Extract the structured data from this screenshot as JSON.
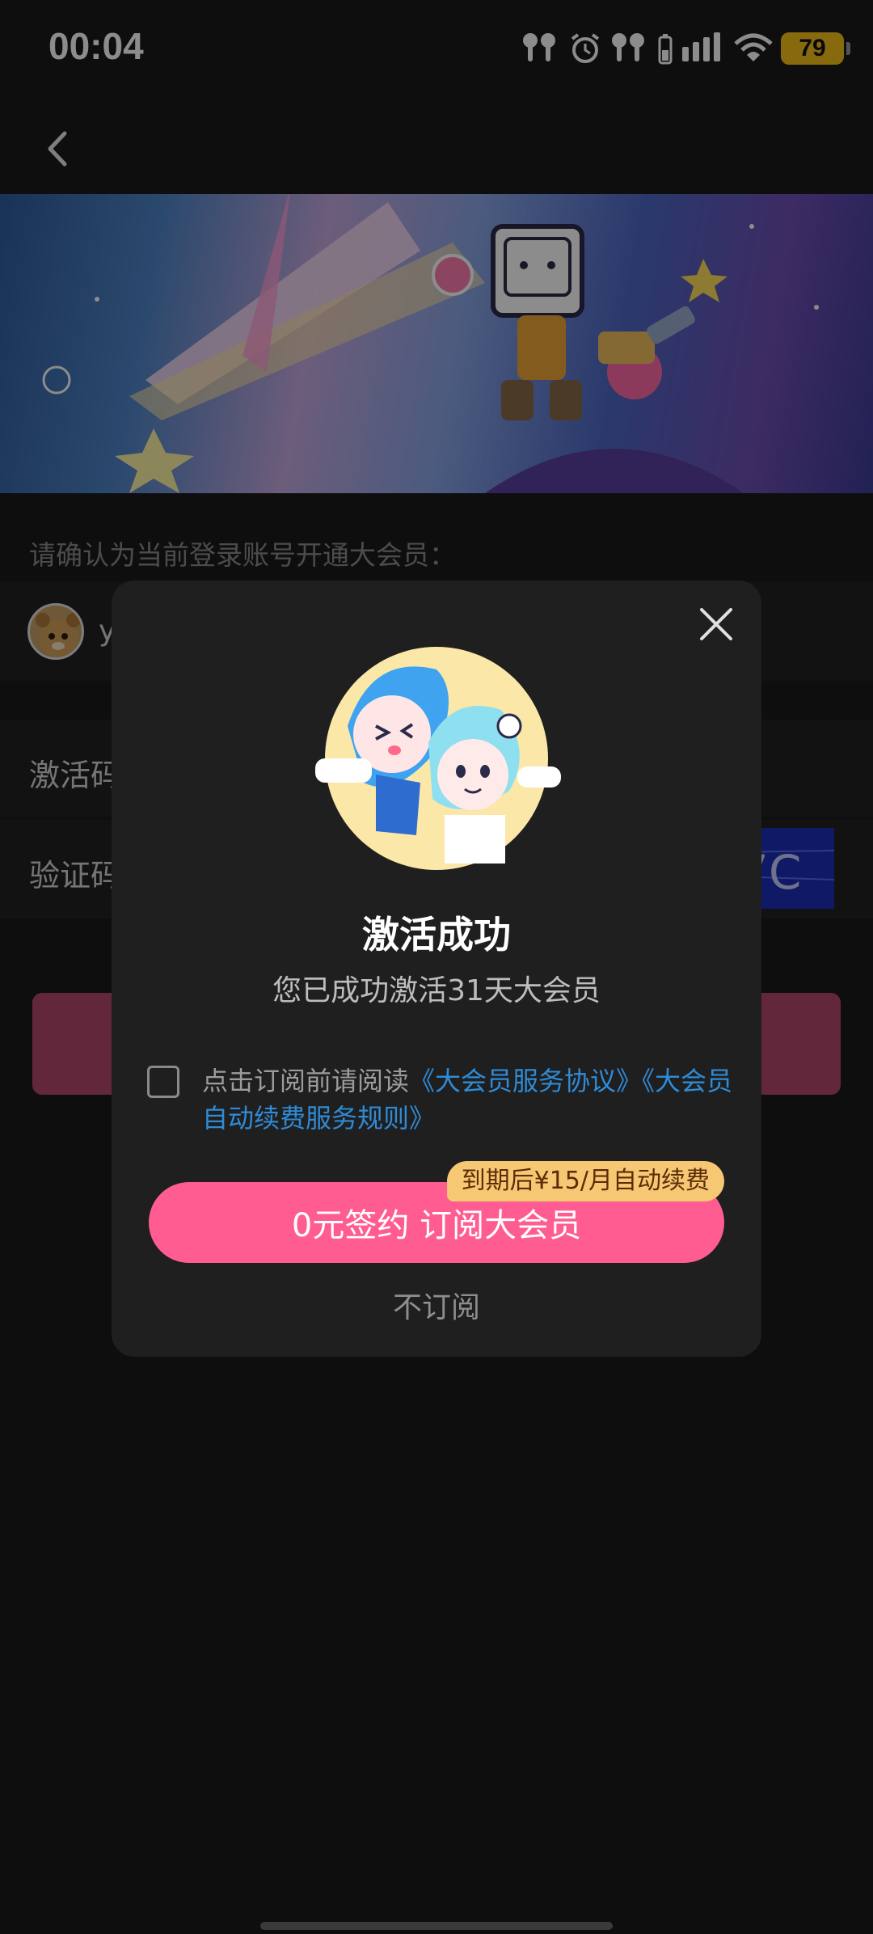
{
  "status_bar": {
    "time": "00:04",
    "battery": "79",
    "icons": [
      "earbuds-icon",
      "alarm-icon",
      "earbuds-case-icon",
      "battery-small-icon",
      "signal-icon",
      "wifi-icon",
      "battery-icon"
    ]
  },
  "nav": {
    "back_icon": "chevron-left-icon"
  },
  "page": {
    "confirm_prompt": "请确认为当前登录账号开通大会员：",
    "account_name": "y",
    "code_label": "激活码",
    "verify_label": "验证码",
    "captcha_text": "7C"
  },
  "modal": {
    "title": "激活成功",
    "subtitle": "您已成功激活31天大会员",
    "agreement_prefix": "点击订阅前请阅读",
    "agreement_link_1": "《大会员服务协议》",
    "agreement_link_2": "《大会员自动续费服务规则》",
    "renew_tag": "到期后¥15/月自动续费",
    "subscribe_button": "0元签约 订阅大会员",
    "decline_button": "不订阅"
  },
  "colors": {
    "accent_pink": "#ff5d91",
    "link_blue": "#2f8bd6",
    "tag_gold": "#f7c873",
    "battery_yellow": "#f7c21b"
  }
}
